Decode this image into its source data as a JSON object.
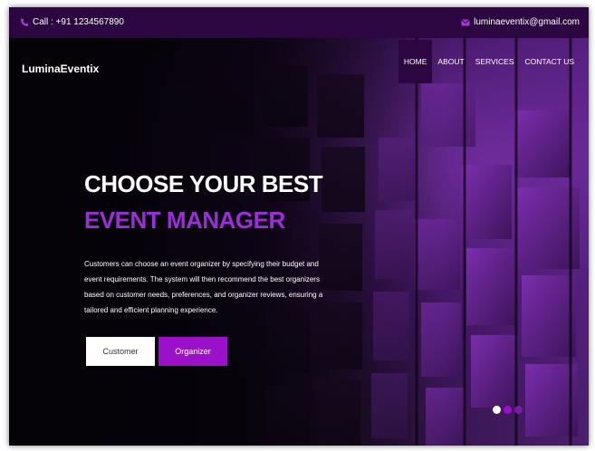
{
  "topbar": {
    "phone_icon": "phone-icon",
    "phone_text": "Call : +91 1234567890",
    "mail_icon": "mail-icon",
    "email_text": "luminaeventix@gmail.com"
  },
  "brand": "LuminaEventix",
  "nav": {
    "items": [
      {
        "label": "HOME",
        "active": true
      },
      {
        "label": "ABOUT",
        "active": false
      },
      {
        "label": "SERVICES",
        "active": false
      },
      {
        "label": "CONTACT US",
        "active": false
      }
    ]
  },
  "hero": {
    "title_line1": "CHOOSE YOUR BEST",
    "title_line2": "EVENT MANAGER",
    "description": "Customers can choose an event organizer by specifying their budget and event requirements. The system will then recommend the best organizers based on customer needs, preferences, and organizer reviews, ensuring a tailored and efficient planning experience.",
    "customer_button": "Customer",
    "organizer_button": "Organizer"
  },
  "carousel": {
    "slides": 3,
    "active_index": 0
  },
  "colors": {
    "topbar": "#2c0640",
    "accent": "#9b11c9",
    "headline_accent": "#9b2fd6",
    "icon_purple": "#a43bd6",
    "dot_active": "#ffffff",
    "dot_inactive_1": "#9b11c9",
    "dot_inactive_2": "#7a1aa8"
  }
}
